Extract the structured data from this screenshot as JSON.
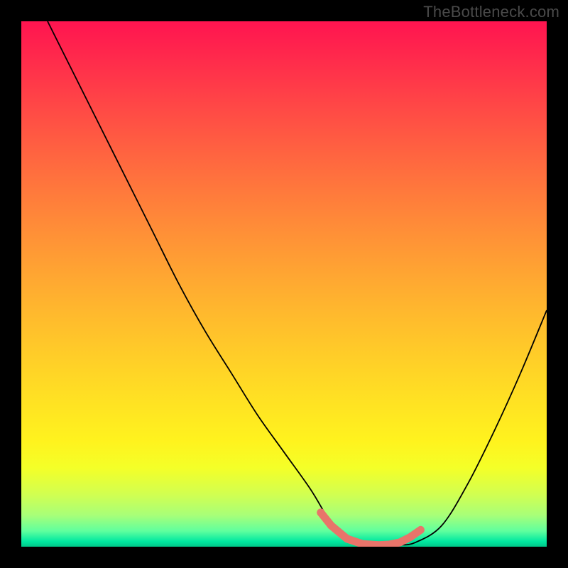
{
  "watermark": "TheBottleneck.com",
  "chart_data": {
    "type": "line",
    "title": "",
    "xlabel": "",
    "ylabel": "",
    "xlim": [
      0,
      100
    ],
    "ylim": [
      0,
      100
    ],
    "series": [
      {
        "name": "bottleneck-curve",
        "x": [
          5,
          10,
          15,
          20,
          25,
          30,
          35,
          40,
          45,
          50,
          55,
          58,
          60,
          62,
          65,
          68,
          70,
          72,
          75,
          80,
          85,
          90,
          95,
          100
        ],
        "y": [
          100,
          90,
          80,
          70,
          60,
          50,
          41,
          33,
          25,
          18,
          11,
          6,
          3,
          1.5,
          0.5,
          0,
          0,
          0.3,
          0.8,
          4,
          12,
          22,
          33,
          45
        ]
      }
    ],
    "markers": {
      "name": "highlight-region",
      "color": "#e8746a",
      "points": [
        {
          "x": 57,
          "y": 6.5
        },
        {
          "x": 59,
          "y": 4
        },
        {
          "x": 62,
          "y": 1.5
        },
        {
          "x": 65,
          "y": 0.5
        },
        {
          "x": 68,
          "y": 0.3
        },
        {
          "x": 70,
          "y": 0.4
        },
        {
          "x": 72,
          "y": 0.8
        },
        {
          "x": 74,
          "y": 1.8
        },
        {
          "x": 76,
          "y": 3.2
        }
      ]
    },
    "gradient": {
      "top": "#ff1450",
      "mid": "#ffe123",
      "bottom": "#00e8a0"
    }
  }
}
